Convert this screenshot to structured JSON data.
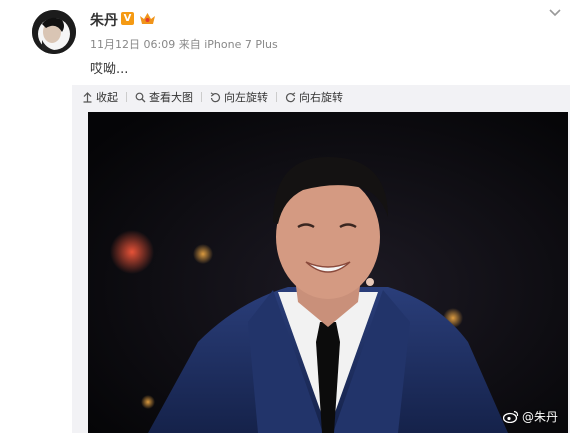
{
  "post": {
    "author": "朱丹",
    "verified_badge": "V",
    "date": "11月12日 06:09",
    "source_prefix": "来自",
    "device": "iPhone 7 Plus",
    "text": "哎呦..."
  },
  "toolbar": {
    "collapse": "收起",
    "view_large": "查看大图",
    "rotate_left": "向左旋转",
    "rotate_right": "向右旋转"
  },
  "image": {
    "watermark": "@朱丹"
  },
  "colors": {
    "author": "#333333",
    "badge": "#f59a13",
    "meta": "#888888",
    "media_bg": "#f2f2f5"
  }
}
